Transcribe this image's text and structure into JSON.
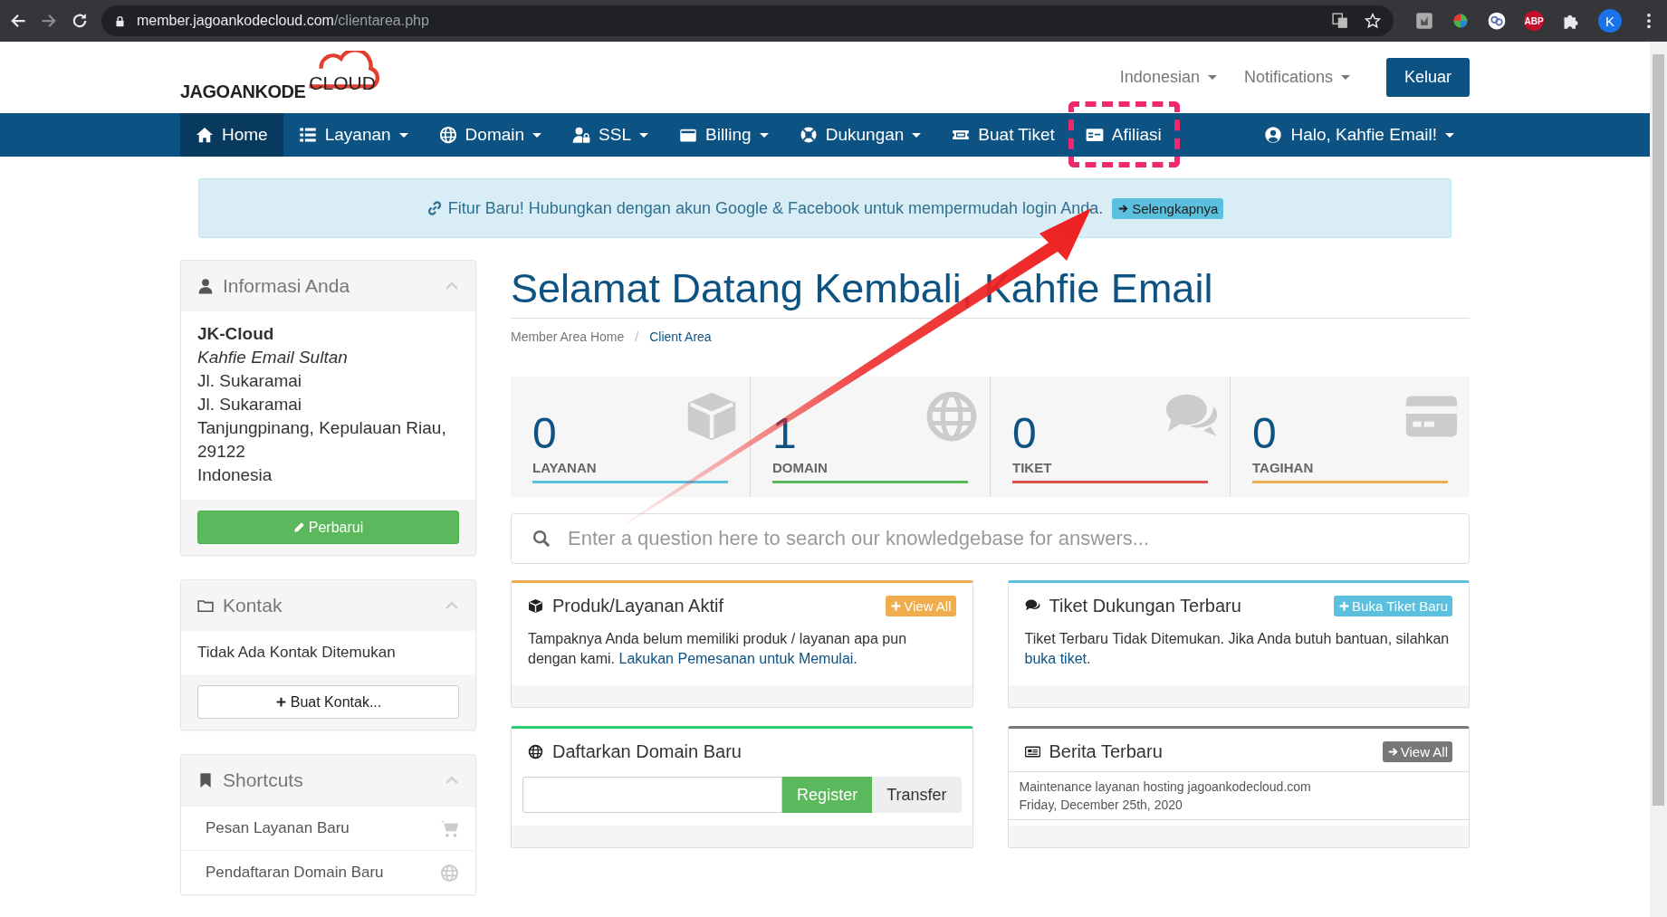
{
  "browser": {
    "url_host": "member.jagoankodecloud.com",
    "url_path": "/clientarea.php",
    "adblock_badge": "ABP",
    "profile_initial": "K"
  },
  "header": {
    "logo_bold": "JAGOANKODE",
    "logo_light": "CLOUD",
    "links": [
      {
        "label": "Indonesian"
      },
      {
        "label": "Notifications"
      }
    ],
    "logout": "Keluar"
  },
  "nav": [
    {
      "label": "Home",
      "selected": true,
      "dropdown": false,
      "highlighted": false
    },
    {
      "label": "Layanan",
      "selected": false,
      "dropdown": true,
      "highlighted": false
    },
    {
      "label": "Domain",
      "selected": false,
      "dropdown": true,
      "highlighted": false
    },
    {
      "label": "SSL",
      "selected": false,
      "dropdown": true,
      "highlighted": false
    },
    {
      "label": "Billing",
      "selected": false,
      "dropdown": true,
      "highlighted": false
    },
    {
      "label": "Dukungan",
      "selected": false,
      "dropdown": true,
      "highlighted": false
    },
    {
      "label": "Buat Tiket",
      "selected": false,
      "dropdown": false,
      "highlighted": false
    },
    {
      "label": "Afiliasi",
      "selected": false,
      "dropdown": false,
      "highlighted": true
    },
    {
      "label": "Halo, Kahfie Email!",
      "selected": false,
      "dropdown": true,
      "highlighted": false
    }
  ],
  "alert": {
    "text": "Fitur Baru! Hubungkan dengan akun Google & Facebook untuk mempermudah login Anda.",
    "button": "Selengkapnya"
  },
  "sidebar": [
    {
      "kind": "info",
      "title": "Informasi Anda",
      "company": "JK-Cloud",
      "name": "Kahfie Email Sultan",
      "lines": [
        "Jl. Sukaramai",
        "Jl. Sukaramai",
        "Tanjungpinang, Kepulauan Riau, 29122",
        "Indonesia"
      ],
      "button": "Perbarui"
    },
    {
      "kind": "contacts",
      "title": "Kontak",
      "empty_text": "Tidak Ada Kontak Ditemukan",
      "button": "Buat Kontak..."
    },
    {
      "kind": "shortcuts",
      "title": "Shortcuts",
      "items": [
        "Pesan Layanan Baru",
        "Pendaftaran Domain Baru"
      ]
    }
  ],
  "main": {
    "title": "Selamat Datang Kembali, Kahfie Email",
    "breadcrumb": {
      "separator": "/",
      "items": [
        {
          "label": "Member Area Home",
          "selected": false
        },
        {
          "label": "Client Area",
          "selected": true
        }
      ]
    },
    "stats": [
      {
        "value": "0",
        "label": "LAYANAN",
        "color": "#5bc0de"
      },
      {
        "value": "1",
        "label": "DOMAIN",
        "color": "#5cb85c"
      },
      {
        "value": "0",
        "label": "TIKET",
        "color": "#d9534f"
      },
      {
        "value": "0",
        "label": "TAGIHAN",
        "color": "#f0ad4e"
      }
    ],
    "search": {
      "placeholder": "Enter a question here to search our knowledgebase for answers..."
    },
    "cards": [
      {
        "kind": "text",
        "title": "Produk/Layanan Aktif",
        "color": "#f0ad4e",
        "button": "View All",
        "text": "Tampaknya Anda belum memiliki produk / layanan apa pun dengan kami. ",
        "link": "Lakukan Pemesanan untuk Memulai",
        "after": "."
      },
      {
        "kind": "text",
        "title": "Tiket Dukungan Terbaru",
        "color": "#5bc0de",
        "button": "Buka Tiket Baru",
        "text": "Tiket Terbaru Tidak Ditemukan. Jika Anda butuh bantuan, silahkan ",
        "link": "buka tiket",
        "after": "."
      },
      {
        "kind": "domain",
        "title": "Daftarkan Domain Baru",
        "color": "#2ecc71",
        "register": "Register",
        "transfer": "Transfer"
      },
      {
        "kind": "news",
        "title": "Berita Terbaru",
        "color": "#777777",
        "button": "View All",
        "news_title": "Maintenance layanan hosting jagoankodecloud.com",
        "news_date": "Friday, December 25th, 2020"
      }
    ]
  }
}
